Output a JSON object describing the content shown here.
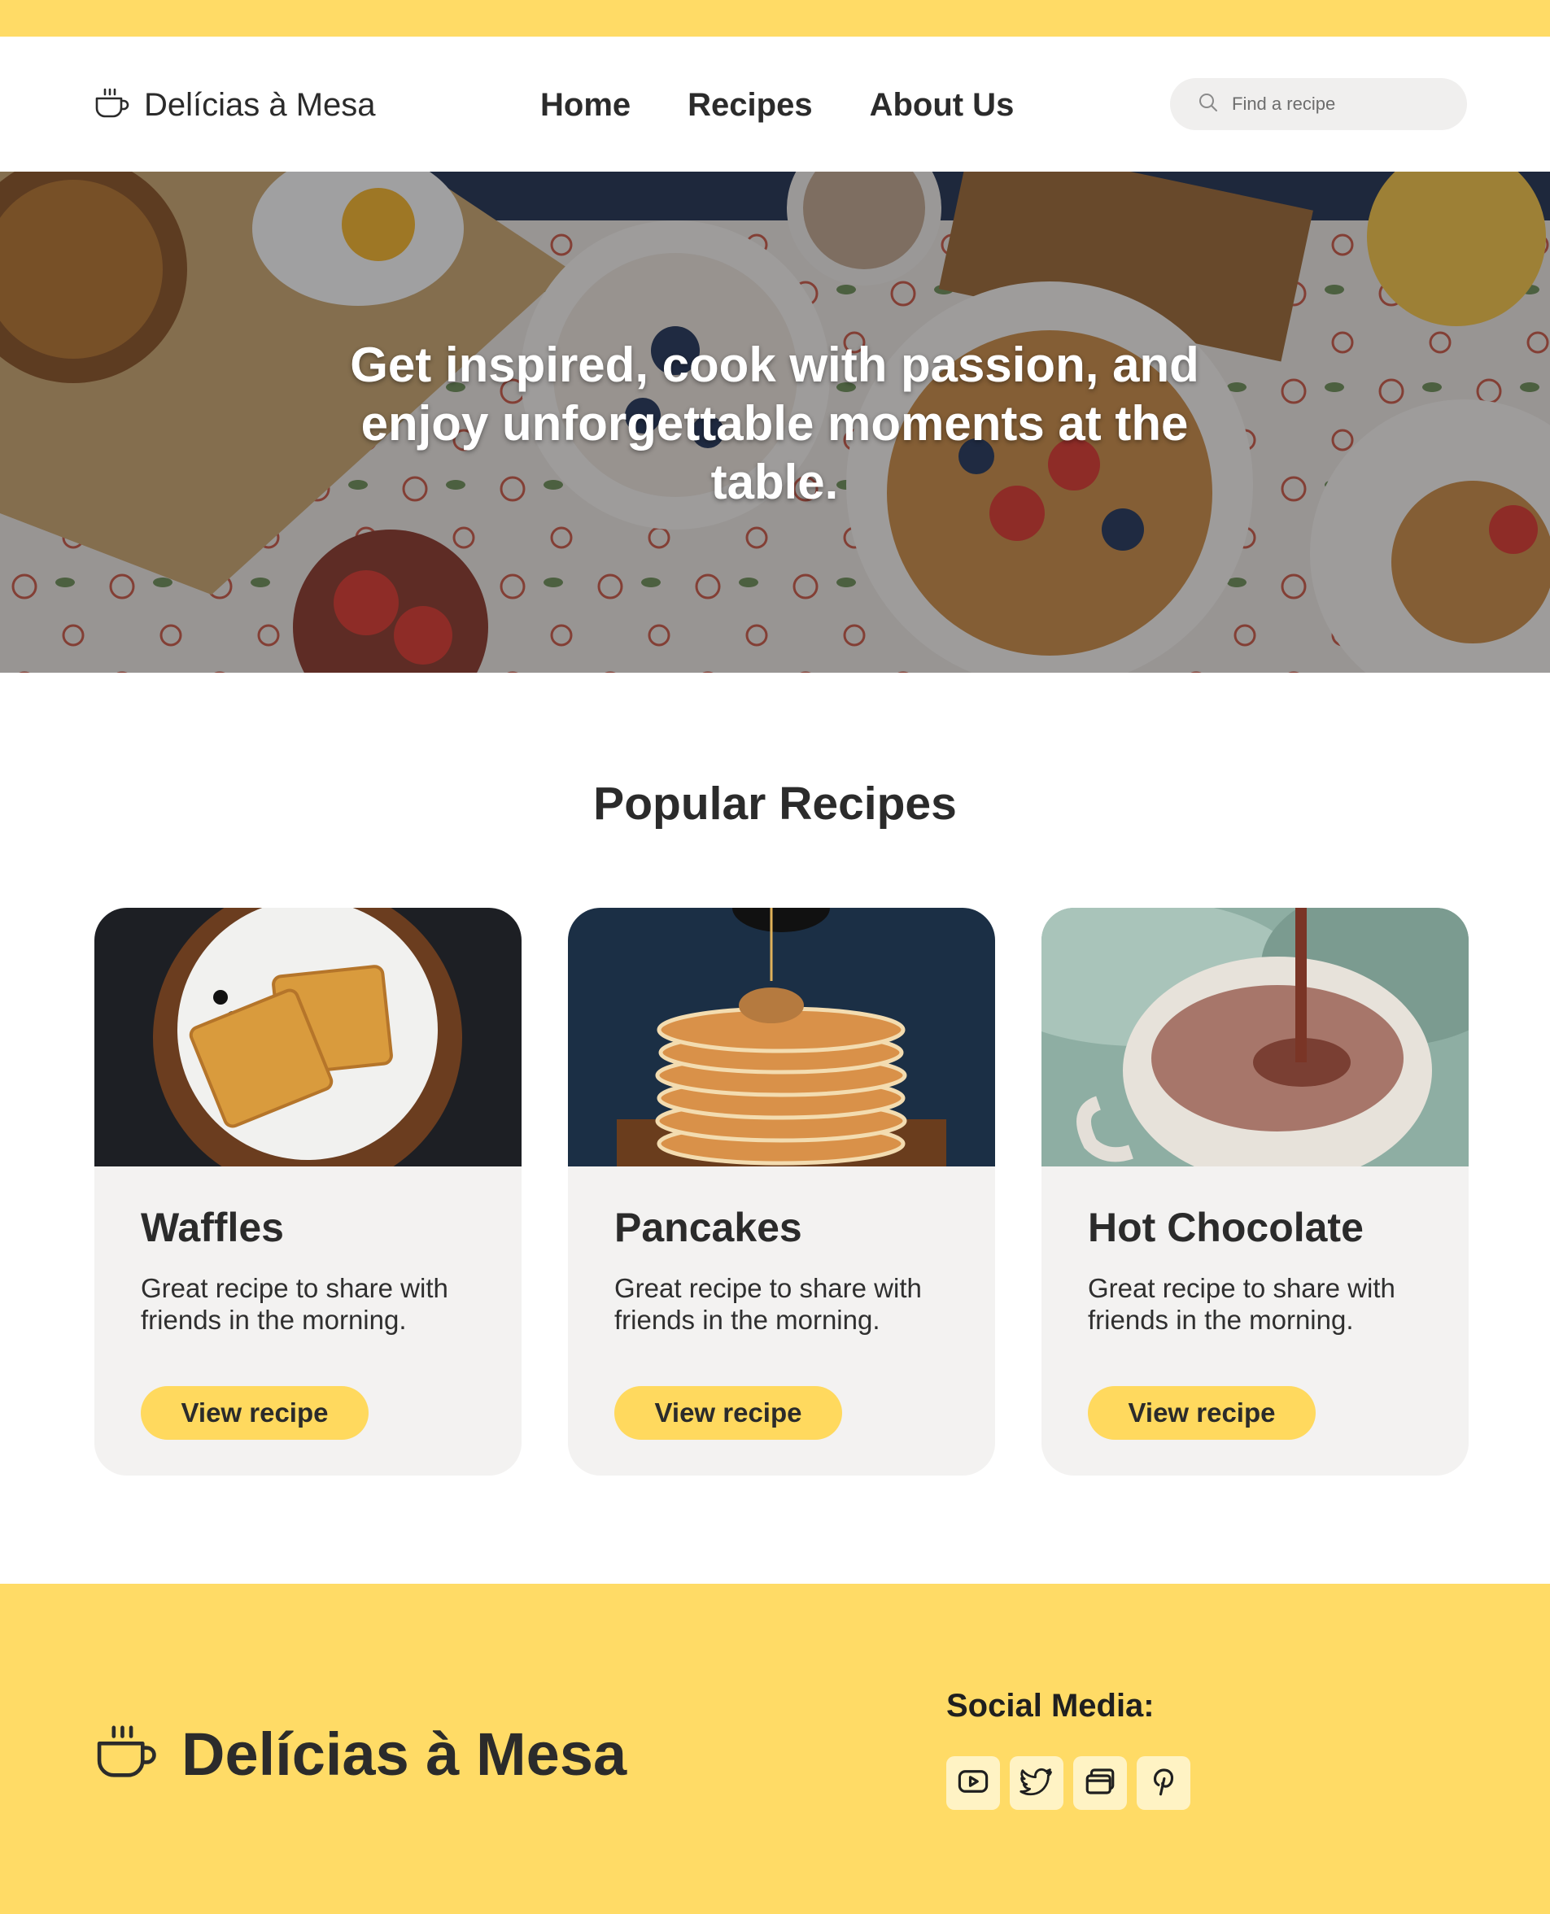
{
  "header": {
    "brand": "Delícias à Mesa",
    "nav": [
      "Home",
      "Recipes",
      "About Us"
    ],
    "search_placeholder": "Find a recipe"
  },
  "hero": {
    "headline": "Get inspired, cook with passion, and enjoy unforgettable moments at the table."
  },
  "popular": {
    "title": "Popular Recipes",
    "cards": [
      {
        "title": "Waffles",
        "description": "Great recipe to share with friends in the morning.",
        "button": "View recipe"
      },
      {
        "title": "Pancakes",
        "description": "Great recipe to share with friends in the morning.",
        "button": "View recipe"
      },
      {
        "title": "Hot Chocolate",
        "description": "Great recipe to share with friends in the morning.",
        "button": "View recipe"
      }
    ]
  },
  "footer": {
    "brand": "Delícias à Mesa",
    "social_title": "Social Media:",
    "social_icons": [
      "youtube-icon",
      "twitter-icon",
      "browser-windows-icon",
      "pinterest-icon"
    ]
  },
  "colors": {
    "accent_yellow": "#ffdb66",
    "button_yellow": "#ffd95e",
    "card_bg": "#f3f2f1",
    "text_dark": "#2b2b2b"
  }
}
